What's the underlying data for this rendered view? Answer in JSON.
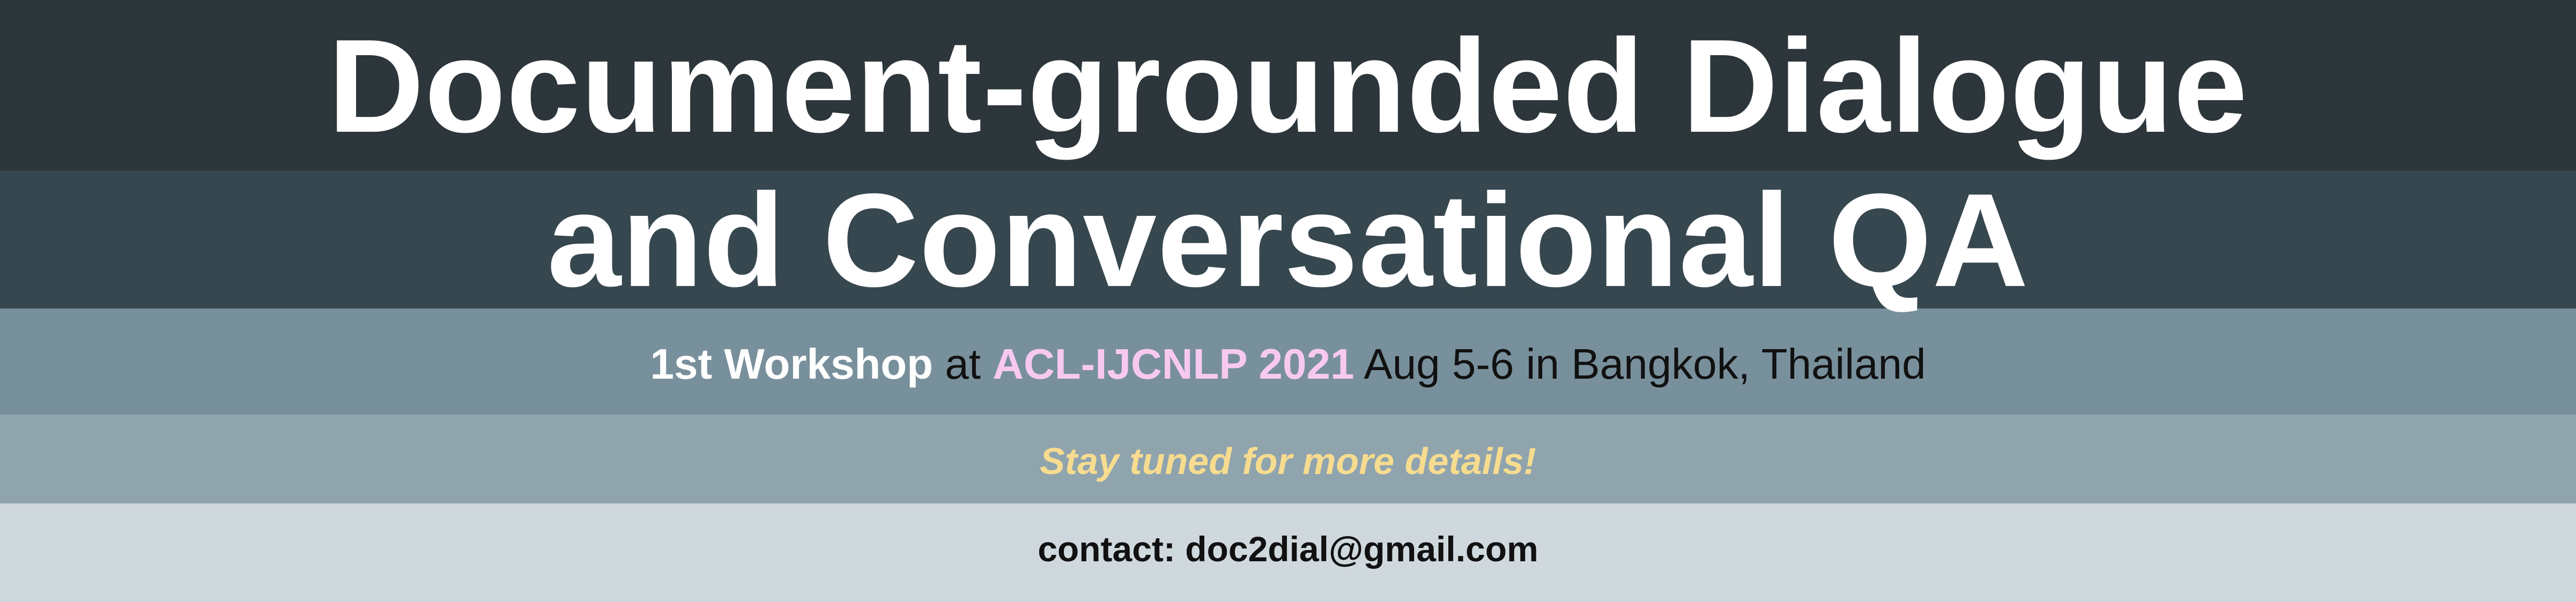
{
  "title": {
    "line1": "Document-grounded Dialogue",
    "line2": "and Conversational QA"
  },
  "subtitle": {
    "workshop": "1st Workshop",
    "at": "at",
    "conference": "ACL-IJCNLP 2021",
    "details": "Aug 5-6 in Bangkok, Thailand"
  },
  "notice": "Stay tuned for more details!",
  "contact": "contact: doc2dial@gmail.com",
  "colors": {
    "band1": "#2c363b",
    "band2": "#37474f",
    "band3": "#78909c",
    "band4": "#90a4ae",
    "band5": "#cfd8dc",
    "title_text": "#ffffff",
    "workshop_text": "#ffffff",
    "body_text": "#111111",
    "conference_accent": "#f8c9f0",
    "notice_accent": "#f7dc8f"
  }
}
